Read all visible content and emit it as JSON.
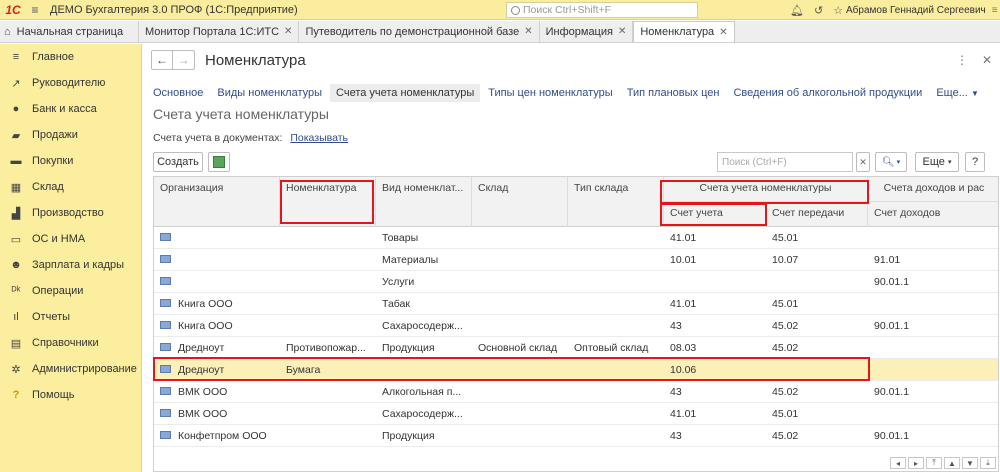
{
  "titlebar": {
    "app_title": "ДЕМО Бухгалтерия 3.0 ПРОФ  (1С:Предприятие)",
    "search_placeholder": "Поиск Ctrl+Shift+F",
    "user": "Абрамов Геннадий Сергеевич"
  },
  "tabs": {
    "home": "Начальная страница",
    "items": [
      {
        "label": "Монитор Портала 1С:ИТС"
      },
      {
        "label": "Путеводитель по демонстрационной базе"
      },
      {
        "label": "Информация"
      },
      {
        "label": "Номенклатура"
      }
    ]
  },
  "sidebar": {
    "items": [
      {
        "label": "Главное",
        "icon": "≡"
      },
      {
        "label": "Руководителю",
        "icon": "↗"
      },
      {
        "label": "Банк и касса",
        "icon": "●"
      },
      {
        "label": "Продажи",
        "icon": "▰"
      },
      {
        "label": "Покупки",
        "icon": "▬"
      },
      {
        "label": "Склад",
        "icon": "▦"
      },
      {
        "label": "Производство",
        "icon": "▟"
      },
      {
        "label": "ОС и НМА",
        "icon": "▭"
      },
      {
        "label": "Зарплата и кадры",
        "icon": "☻"
      },
      {
        "label": "Операции",
        "icon": "ᴰᵏ"
      },
      {
        "label": "Отчеты",
        "icon": "ıl"
      },
      {
        "label": "Справочники",
        "icon": "▤"
      },
      {
        "label": "Администрирование",
        "icon": "✲"
      },
      {
        "label": "Помощь",
        "icon": "?"
      }
    ]
  },
  "form": {
    "title": "Номенклатура",
    "links": [
      "Основное",
      "Виды номенклатуры",
      "Счета учета номенклатуры",
      "Типы цен номенклатуры",
      "Тип плановых цен",
      "Сведения об алкогольной продукции",
      "Еще..."
    ],
    "section_title": "Счета учета номенклатуры",
    "accounts_label": "Счета учета в документах:",
    "accounts_show": "Показывать",
    "create": "Создать",
    "filter_placeholder": "Поиск (Ctrl+F)",
    "more": "Еще",
    "help": "?"
  },
  "table": {
    "headers": {
      "org": "Организация",
      "nom": "Номенклатура",
      "kind": "Вид номенклат...",
      "stock": "Склад",
      "stock_type": "Тип склада",
      "group_acc": "Счета учета номенклатуры",
      "acc": "Счет учета",
      "transfer": "Счет передачи",
      "group_income": "Счета доходов и рас",
      "income": "Счет доходов"
    },
    "rows": [
      {
        "org": "",
        "nom": "",
        "kind": "Товары",
        "stock": "",
        "stock_type": "",
        "acc": "41.01",
        "transfer": "45.01",
        "income": ""
      },
      {
        "org": "",
        "nom": "",
        "kind": "Материалы",
        "stock": "",
        "stock_type": "",
        "acc": "10.01",
        "transfer": "10.07",
        "income": "91.01"
      },
      {
        "org": "",
        "nom": "",
        "kind": "Услуги",
        "stock": "",
        "stock_type": "",
        "acc": "",
        "transfer": "",
        "income": "90.01.1"
      },
      {
        "org": "Книга ООО",
        "nom": "",
        "kind": "Табак",
        "stock": "",
        "stock_type": "",
        "acc": "41.01",
        "transfer": "45.01",
        "income": ""
      },
      {
        "org": "Книга ООО",
        "nom": "",
        "kind": "Сахаросодерж...",
        "stock": "",
        "stock_type": "",
        "acc": "43",
        "transfer": "45.02",
        "income": "90.01.1"
      },
      {
        "org": "Дредноут",
        "nom": "Противопожар...",
        "kind": "Продукция",
        "stock": "Основной склад",
        "stock_type": "Оптовый склад",
        "acc": "08.03",
        "transfer": "45.02",
        "income": ""
      },
      {
        "org": "Дредноут",
        "nom": "Бумага",
        "kind": "",
        "stock": "",
        "stock_type": "",
        "acc": "10.06",
        "transfer": "",
        "income": "",
        "selected": true
      },
      {
        "org": "ВМК ООО",
        "nom": "",
        "kind": "Алкогольная п...",
        "stock": "",
        "stock_type": "",
        "acc": "43",
        "transfer": "45.02",
        "income": "90.01.1"
      },
      {
        "org": "ВМК ООО",
        "nom": "",
        "kind": "Сахаросодерж...",
        "stock": "",
        "stock_type": "",
        "acc": "41.01",
        "transfer": "45.01",
        "income": ""
      },
      {
        "org": "Конфетпром ООО",
        "nom": "",
        "kind": "Продукция",
        "stock": "",
        "stock_type": "",
        "acc": "43",
        "transfer": "45.02",
        "income": "90.01.1"
      }
    ]
  },
  "colors": {
    "sidebar_bg": "#fbee9f",
    "selected_row": "#fbf0b8",
    "link": "#2f4c8f",
    "highlight": "#e3171b"
  }
}
